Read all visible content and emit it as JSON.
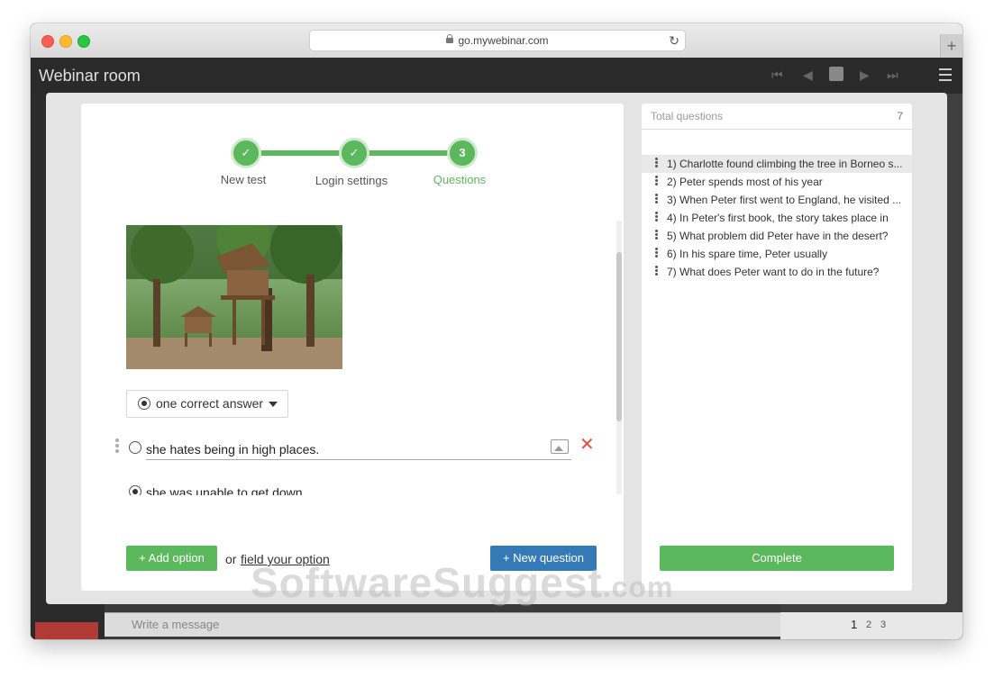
{
  "browser": {
    "url": "go.mywebinar.com",
    "newtab_label": "+"
  },
  "app": {
    "title": "Webinar room"
  },
  "stepper": {
    "steps": [
      {
        "label": "New test",
        "mark": "✓"
      },
      {
        "label": "Login settings",
        "mark": "✓"
      },
      {
        "label": "Questions",
        "mark": "3"
      }
    ]
  },
  "question": {
    "answer_type": "one correct answer",
    "options": [
      {
        "text": "she hates being in high places."
      },
      {
        "text": "she was unable to get down"
      }
    ],
    "add_option_label": "+ Add option",
    "or_text": "or",
    "field_option_label": "field your option",
    "new_question_label": "+ New question"
  },
  "panel": {
    "header": "Total questions",
    "count": "7",
    "questions": [
      "1) Charlotte found climbing the tree in Borneo s...",
      "2) Peter spends most of his year",
      "3) When Peter first went to England, he visited ...",
      "4) In Peter's first book, the story takes place in",
      "5) What problem did Peter have in the desert?",
      "6) In his spare time, Peter usually",
      "7) What does Peter want to do in the future?"
    ],
    "complete_label": "Complete"
  },
  "chat": {
    "placeholder": "Write a message"
  },
  "pagination": [
    "1",
    "2",
    "3"
  ],
  "watermark": {
    "text": "SoftwareSuggest",
    "suffix": ".com"
  },
  "colors": {
    "accent_green": "#5cb85c",
    "accent_blue": "#337ab7",
    "delete_red": "#e74c3c"
  }
}
